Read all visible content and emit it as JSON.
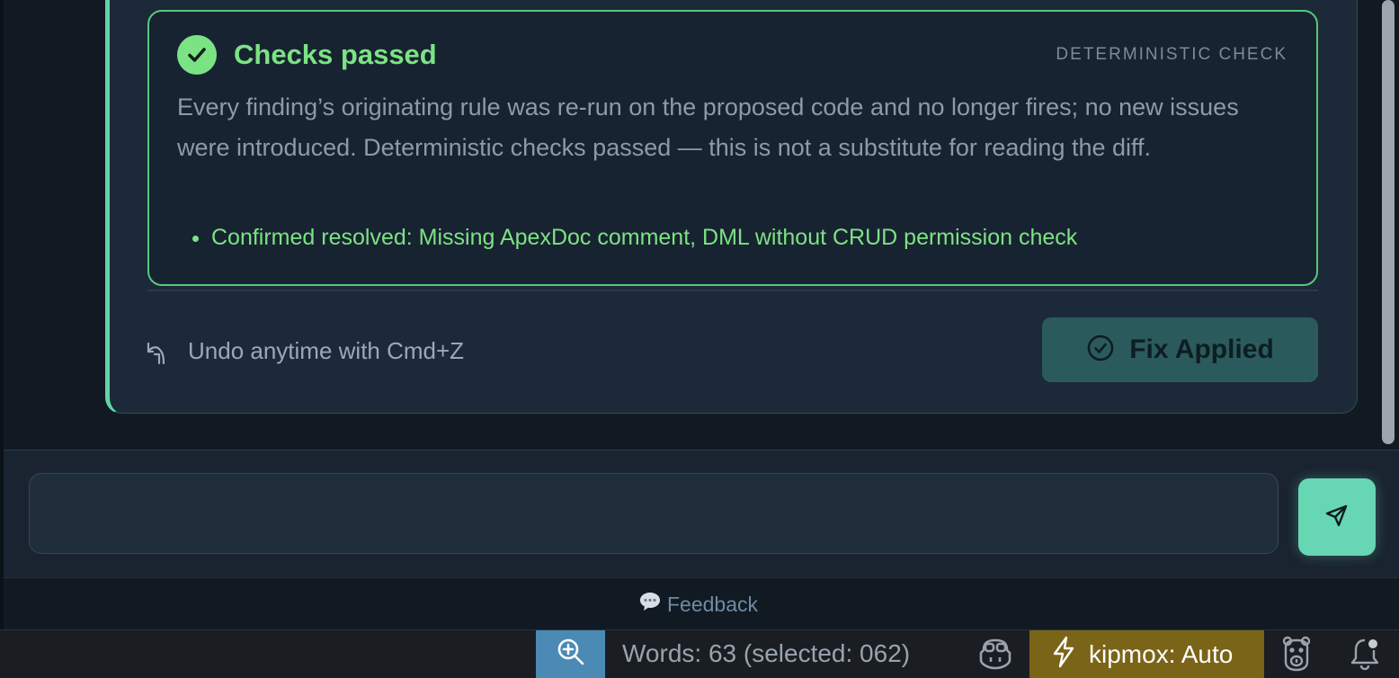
{
  "check_result": {
    "title": "Checks passed",
    "tag": "DETERMINISTIC CHECK",
    "body": "Every finding’s originating rule was re-run on the proposed code and no longer fires; no new issues were introduced. Deterministic checks passed — this is not a substitute for reading the diff.",
    "items": [
      "Confirmed resolved: Missing ApexDoc comment, DML without CRUD permission check"
    ],
    "status_color": "#7be383"
  },
  "actions": {
    "undo_text": "Undo anytime with Cmd+Z",
    "fix_button_label": "Fix Applied"
  },
  "chat": {
    "input_value": "",
    "input_placeholder": "",
    "feedback_label": "Feedback"
  },
  "status_bar": {
    "words": "Words: 63 (selected: 062)",
    "model": "kipmox: Auto",
    "zoom_icon": "zoom-in-icon",
    "copilot_icon": "copilot-icon",
    "bolt_icon": "lightning-icon",
    "bear_icon": "bear-icon",
    "bell_icon": "notification-bell-icon"
  },
  "colors": {
    "accent": "#67d6b3",
    "success": "#7be383",
    "status_zoom_bg": "#4a8ab5",
    "status_model_bg": "#7a6417"
  }
}
